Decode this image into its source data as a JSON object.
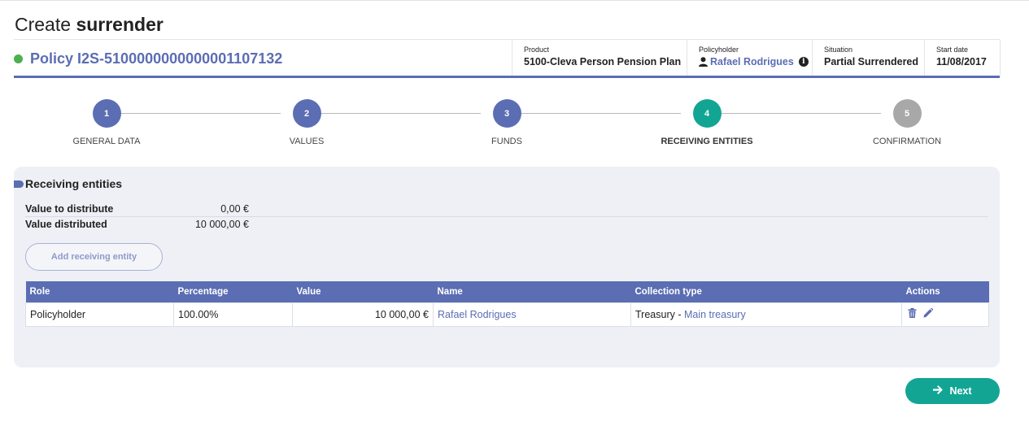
{
  "header": {
    "title_prefix": "Create",
    "title_strong": "surrender"
  },
  "policy": {
    "title": "Policy I2S-5100000000000001107132",
    "status_color": "#4caf50",
    "fields": [
      {
        "label": "Product",
        "value": "5100-Cleva Person Pension Plan"
      },
      {
        "label": "Policyholder",
        "value": "Rafael Rodrigues"
      },
      {
        "label": "Situation",
        "value": "Partial Surrendered"
      },
      {
        "label": "Start date",
        "value": "11/08/2017"
      }
    ]
  },
  "stepper": {
    "steps": [
      {
        "number": "1",
        "label": "GENERAL DATA",
        "state": "done",
        "color": "#5b6db3"
      },
      {
        "number": "2",
        "label": "VALUES",
        "state": "done",
        "color": "#5b6db3"
      },
      {
        "number": "3",
        "label": "FUNDS",
        "state": "done",
        "color": "#5b6db3"
      },
      {
        "number": "4",
        "label": "RECEIVING ENTITIES",
        "state": "active",
        "color": "#13a594"
      },
      {
        "number": "5",
        "label": "CONFIRMATION",
        "state": "pending",
        "color": "#a8a8a8"
      }
    ]
  },
  "section": {
    "title": "Receiving entities",
    "summary": [
      {
        "label": "Value to distribute",
        "value": "0,00 €"
      },
      {
        "label": "Value distributed",
        "value": "10 000,00 €"
      }
    ],
    "add_button": "Add receiving entity"
  },
  "table": {
    "columns": [
      "Role",
      "Percentage",
      "Value",
      "Name",
      "Collection type",
      "Actions"
    ],
    "rows": [
      {
        "role": "Policyholder",
        "percentage": "100.00%",
        "value": "10 000,00 €",
        "name": "Rafael Rodrigues",
        "collection_prefix": "Treasury - ",
        "collection_link": "Main treasury",
        "actions": [
          "trash-icon",
          "pencil-icon"
        ]
      }
    ]
  },
  "footer": {
    "next_label": "Next"
  },
  "colors": {
    "accent": "#5b6db3",
    "success": "#13a594",
    "panel": "#eef0f5"
  }
}
